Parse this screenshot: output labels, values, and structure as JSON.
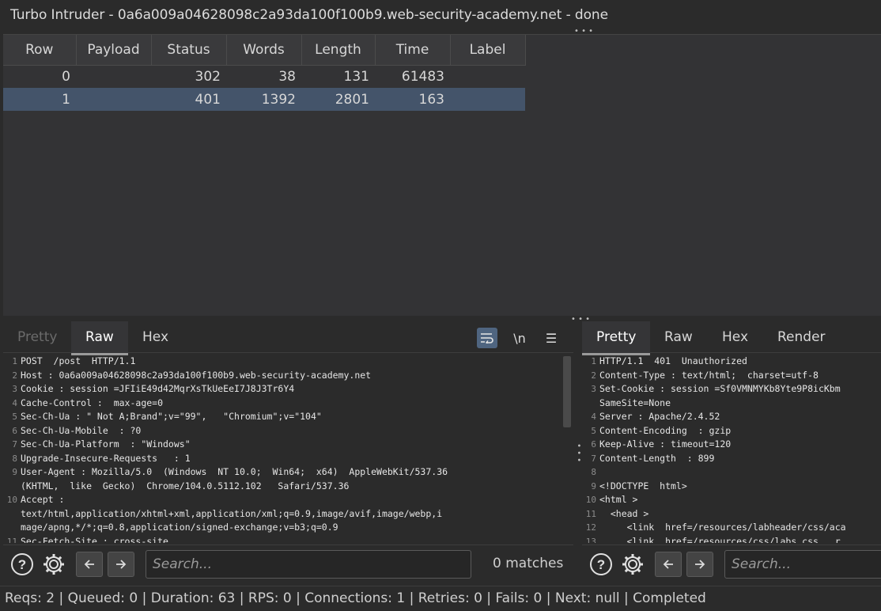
{
  "window": {
    "title": "Turbo Intruder - 0a6a009a04628098c2a93da100f100b9.web-security-academy.net - done"
  },
  "results": {
    "columns": [
      "Row",
      "Payload",
      "Status",
      "Words",
      "Length",
      "Time",
      "Label"
    ],
    "rows": [
      {
        "row": "0",
        "payload": "",
        "status": "302",
        "words": "38",
        "length": "131",
        "time": "61483",
        "label": ""
      },
      {
        "row": "1",
        "payload": "",
        "status": "401",
        "words": "1392",
        "length": "2801",
        "time": "163",
        "label": ""
      }
    ],
    "selected_row": 1
  },
  "request_editor": {
    "tabs": [
      "Pretty",
      "Raw",
      "Hex"
    ],
    "active_tab": "Raw",
    "tools": {
      "wrap": "⮐",
      "newline": "\\n",
      "menu": "☰"
    },
    "lines": [
      {
        "n": "1",
        "text": "POST  /post  HTTP/1.1"
      },
      {
        "n": "2",
        "text": "Host : 0a6a009a04628098c2a93da100f100b9.web-security-academy.net"
      },
      {
        "n": "3",
        "text": "Cookie : session =JFIiE49d42MqrXsTkUeEeI7J8J3Tr6Y4"
      },
      {
        "n": "4",
        "text": "Cache-Control :  max-age=0"
      },
      {
        "n": "5",
        "text": "Sec-Ch-Ua : \" Not A;Brand\";v=\"99\",   \"Chromium\";v=\"104\""
      },
      {
        "n": "6",
        "text": "Sec-Ch-Ua-Mobile  : ?0"
      },
      {
        "n": "7",
        "text": "Sec-Ch-Ua-Platform  : \"Windows\""
      },
      {
        "n": "8",
        "text": "Upgrade-Insecure-Requests   : 1"
      },
      {
        "n": "9",
        "text": "User-Agent : Mozilla/5.0  (Windows  NT 10.0;  Win64;  x64)  AppleWebKit/537.36"
      },
      {
        "n": "",
        "text": "(KHTML,  like  Gecko)  Chrome/104.0.5112.102   Safari/537.36"
      },
      {
        "n": "10",
        "text": "Accept :"
      },
      {
        "n": "",
        "text": "text/html,application/xhtml+xml,application/xml;q=0.9,image/avif,image/webp,i"
      },
      {
        "n": "",
        "text": "mage/apng,*/*;q=0.8,application/signed-exchange;v=b3;q=0.9"
      },
      {
        "n": "11",
        "text": "Sec-Fetch-Site : cross-site"
      }
    ],
    "search_placeholder": "Search...",
    "matches": "0 matches"
  },
  "response_editor": {
    "tabs": [
      "Pretty",
      "Raw",
      "Hex",
      "Render"
    ],
    "active_tab": "Pretty",
    "lines": [
      {
        "n": "1",
        "text": "HTTP/1.1  401  Unauthorized"
      },
      {
        "n": "2",
        "text": "Content-Type : text/html;  charset=utf-8"
      },
      {
        "n": "3",
        "text": "Set-Cookie : session =Sf0VMNMYKb8Yte9P8icKbm"
      },
      {
        "n": "",
        "text": "SameSite=None"
      },
      {
        "n": "4",
        "text": "Server : Apache/2.4.52"
      },
      {
        "n": "5",
        "text": "Content-Encoding  : gzip"
      },
      {
        "n": "6",
        "text": "Keep-Alive : timeout=120"
      },
      {
        "n": "7",
        "text": "Content-Length  : 899"
      },
      {
        "n": "8",
        "text": ""
      },
      {
        "n": "9",
        "text": "<!DOCTYPE  html>"
      },
      {
        "n": "10",
        "text": "<html >"
      },
      {
        "n": "11",
        "text": "  <head >"
      },
      {
        "n": "12",
        "text": "     <link  href=/resources/labheader/css/aca"
      },
      {
        "n": "13",
        "text": "     <link  href=/resources/css/labs.css   r"
      }
    ],
    "search_placeholder": "Search..."
  },
  "status_bar": {
    "text": "Reqs: 2 | Queued: 0 | Duration: 63 | RPS: 0 | Connections: 1 | Retries: 0 | Fails: 0 | Next: null | Completed"
  },
  "colors": {
    "background": "#2b2b2b",
    "table_bg": "#333335",
    "selected_row": "#44546a",
    "tool_active": "#4f6580"
  }
}
